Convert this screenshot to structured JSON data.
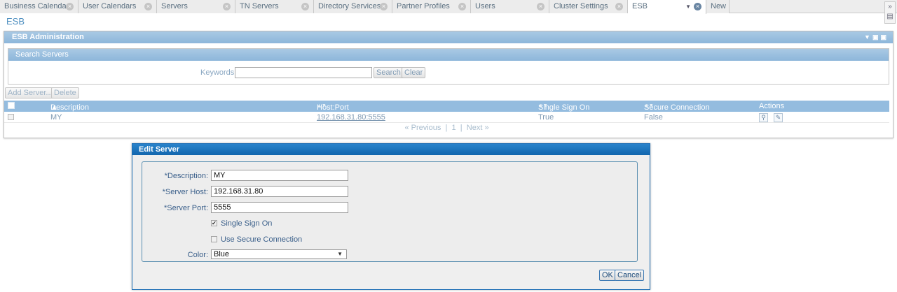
{
  "tabs": [
    {
      "label": "Business Calendars",
      "active": false
    },
    {
      "label": "User Calendars",
      "active": false
    },
    {
      "label": "Servers",
      "active": false
    },
    {
      "label": "TN Servers",
      "active": false
    },
    {
      "label": "Directory Services",
      "active": false
    },
    {
      "label": "Partner Profiles",
      "active": false
    },
    {
      "label": "Users",
      "active": false
    },
    {
      "label": "Cluster Settings",
      "active": false
    },
    {
      "label": "ESB",
      "active": true
    },
    {
      "label": "New",
      "active": false
    }
  ],
  "page_title": "ESB",
  "panel": {
    "title": "ESB Administration",
    "search": {
      "title": "Search Servers",
      "keywords_label": "Keywords:",
      "keywords_value": "",
      "search_button": "Search",
      "clear_button": "Clear"
    },
    "toolbar": {
      "add_button": "Add Server...",
      "delete_button": "Delete"
    },
    "columns": [
      "Description",
      "Host:Port",
      "Single Sign On",
      "Secure Connection",
      "Actions"
    ],
    "rows": [
      {
        "description": "MY",
        "host_port": "192.168.31.80:5555",
        "single_sign_on": "True",
        "secure_connection": "False"
      }
    ],
    "pager": {
      "previous": "« Previous",
      "page": "1",
      "next": "Next »",
      "sep": "|"
    }
  },
  "dialog": {
    "title": "Edit Server",
    "description_label": "*Description:",
    "description_value": "MY",
    "host_label": "*Server Host:",
    "host_value": "192.168.31.80",
    "port_label": "*Server Port:",
    "port_value": "5555",
    "sso_label": "Single Sign On",
    "sso_checked": true,
    "secure_label": "Use Secure Connection",
    "secure_checked": false,
    "color_label": "Color:",
    "color_value": "Blue",
    "ok_button": "OK",
    "cancel_button": "Cancel"
  },
  "colors": {
    "accent": "#8db6da",
    "dialog_header": "#1266ad",
    "link": "#7f9ab3"
  }
}
